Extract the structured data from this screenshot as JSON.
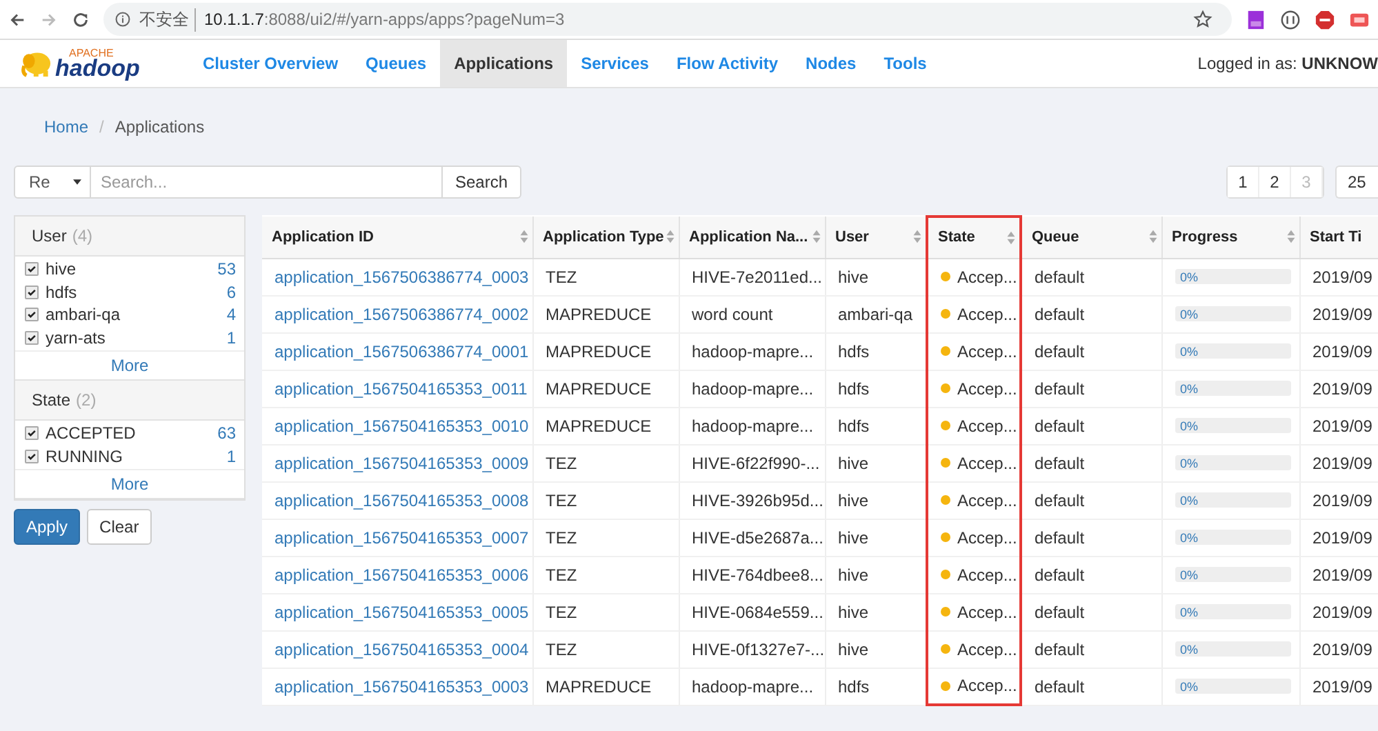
{
  "browser": {
    "security": "不安全",
    "url_host": "10.1.1.7",
    "url_path": ":8088/ui2/#/yarn-apps/apps?pageNum=3"
  },
  "navbar": {
    "logo_top": "APACHE",
    "logo_main": "hadoop",
    "items": [
      {
        "label": "Cluster Overview",
        "selected": false
      },
      {
        "label": "Queues",
        "selected": false
      },
      {
        "label": "Applications",
        "selected": true
      },
      {
        "label": "Services",
        "selected": false
      },
      {
        "label": "Flow Activity",
        "selected": false
      },
      {
        "label": "Nodes",
        "selected": false
      },
      {
        "label": "Tools",
        "selected": false
      }
    ],
    "login": "Logged in as: **UNKNOW**"
  },
  "breadcrumb": {
    "separator": "/",
    "items": [
      {
        "label": "Home",
        "link": true
      },
      {
        "label": "Applications",
        "link": false
      }
    ]
  },
  "search": {
    "scope": "Re",
    "placeholder": "Search...",
    "button": "Search"
  },
  "pagination": {
    "pages": [
      {
        "label": "1",
        "disabled": false
      },
      {
        "label": "2",
        "disabled": false
      },
      {
        "label": "3",
        "disabled": true
      }
    ],
    "page_size": "25"
  },
  "filters": [
    {
      "title": "User",
      "count": "(4)",
      "items": [
        {
          "label": "hive",
          "count": "53",
          "checked": true
        },
        {
          "label": "hdfs",
          "count": "6",
          "checked": true
        },
        {
          "label": "ambari-qa",
          "count": "4",
          "checked": true
        },
        {
          "label": "yarn-ats",
          "count": "1",
          "checked": true
        }
      ],
      "more": "More"
    },
    {
      "title": "State",
      "count": "(2)",
      "items": [
        {
          "label": "ACCEPTED",
          "count": "63",
          "checked": true
        },
        {
          "label": "RUNNING",
          "count": "1",
          "checked": true
        }
      ],
      "more": "More"
    }
  ],
  "filter_buttons": {
    "apply": "Apply",
    "clear": "Clear"
  },
  "table": {
    "columns": [
      {
        "label": "Application ID",
        "sortable": true,
        "highlighted": false
      },
      {
        "label": "Application Type",
        "sortable": true,
        "highlighted": false
      },
      {
        "label": "Application Na...",
        "sortable": true,
        "highlighted": false
      },
      {
        "label": "User",
        "sortable": true,
        "highlighted": false
      },
      {
        "label": "State",
        "sortable": true,
        "highlighted": true
      },
      {
        "label": "Queue",
        "sortable": true,
        "highlighted": false
      },
      {
        "label": "Progress",
        "sortable": true,
        "highlighted": false
      },
      {
        "label": "Start Ti",
        "sortable": false,
        "highlighted": false
      }
    ],
    "rows": [
      {
        "id": "application_1567506386774_0003",
        "type": "TEZ",
        "name": "HIVE-7e2011ed...",
        "user": "hive",
        "state": "Accep...",
        "color": "#f5b50f",
        "queue": "default",
        "progress": "0%",
        "level": 0,
        "start": "2019/09"
      },
      {
        "id": "application_1567506386774_0002",
        "type": "MAPREDUCE",
        "name": "word count",
        "user": "ambari-qa",
        "state": "Accep...",
        "color": "#f5b50f",
        "queue": "default",
        "progress": "0%",
        "level": 0,
        "start": "2019/09"
      },
      {
        "id": "application_1567506386774_0001",
        "type": "MAPREDUCE",
        "name": "hadoop-mapre...",
        "user": "hdfs",
        "state": "Accep...",
        "color": "#f5b50f",
        "queue": "default",
        "progress": "0%",
        "level": 0,
        "start": "2019/09"
      },
      {
        "id": "application_1567504165353_0011",
        "type": "MAPREDUCE",
        "name": "hadoop-mapre...",
        "user": "hdfs",
        "state": "Accep...",
        "color": "#f5b50f",
        "queue": "default",
        "progress": "0%",
        "level": 0,
        "start": "2019/09"
      },
      {
        "id": "application_1567504165353_0010",
        "type": "MAPREDUCE",
        "name": "hadoop-mapre...",
        "user": "hdfs",
        "state": "Accep...",
        "color": "#f5b50f",
        "queue": "default",
        "progress": "0%",
        "level": 0,
        "start": "2019/09"
      },
      {
        "id": "application_1567504165353_0009",
        "type": "TEZ",
        "name": "HIVE-6f22f990-...",
        "user": "hive",
        "state": "Accep...",
        "color": "#f5b50f",
        "queue": "default",
        "progress": "0%",
        "level": 0,
        "start": "2019/09"
      },
      {
        "id": "application_1567504165353_0008",
        "type": "TEZ",
        "name": "HIVE-3926b95d...",
        "user": "hive",
        "state": "Accep...",
        "color": "#f5b50f",
        "queue": "default",
        "progress": "0%",
        "level": 0,
        "start": "2019/09"
      },
      {
        "id": "application_1567504165353_0007",
        "type": "TEZ",
        "name": "HIVE-d5e2687a...",
        "user": "hive",
        "state": "Accep...",
        "color": "#f5b50f",
        "queue": "default",
        "progress": "0%",
        "level": 0,
        "start": "2019/09"
      },
      {
        "id": "application_1567504165353_0006",
        "type": "TEZ",
        "name": "HIVE-764dbee8...",
        "user": "hive",
        "state": "Accep...",
        "color": "#f5b50f",
        "queue": "default",
        "progress": "0%",
        "level": 0,
        "start": "2019/09"
      },
      {
        "id": "application_1567504165353_0005",
        "type": "TEZ",
        "name": "HIVE-0684e559...",
        "user": "hive",
        "state": "Accep...",
        "color": "#f5b50f",
        "queue": "default",
        "progress": "0%",
        "level": 0,
        "start": "2019/09"
      },
      {
        "id": "application_1567504165353_0004",
        "type": "TEZ",
        "name": "HIVE-0f1327e7-...",
        "user": "hive",
        "state": "Accep...",
        "color": "#f5b50f",
        "queue": "default",
        "progress": "0%",
        "level": 0,
        "start": "2019/09"
      },
      {
        "id": "application_1567504165353_0003",
        "type": "MAPREDUCE",
        "name": "hadoop-mapre...",
        "user": "hdfs",
        "state": "Accep...",
        "color": "#f5b50f",
        "queue": "default",
        "progress": "0%",
        "level": 0,
        "start": "2019/09"
      }
    ]
  }
}
